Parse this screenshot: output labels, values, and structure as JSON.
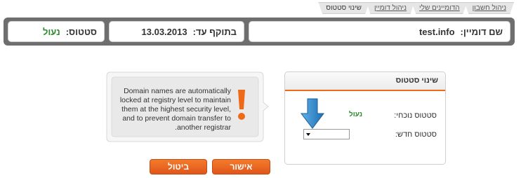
{
  "breadcrumbs": [
    "ניהול חשבון",
    "הדומיינים שלי",
    "ניהול דומיין",
    "שינוי סטטוס"
  ],
  "domain_bar": {
    "domain_label": "שם דומיין:",
    "domain_value": "test.info",
    "expiry_label": "בתוקף עד:",
    "expiry_value": "13.03.2013",
    "status_label": "סטטוס:",
    "status_value": "נעול"
  },
  "status_box": {
    "title": "שינוי סטטוס",
    "current_label": "סטטוס נוכחי:",
    "current_value": "נעול",
    "new_label": "סטטוס חדש:"
  },
  "info": {
    "text": "Domain names are automatically locked at registry level to maintain them at the highest security level, and to prevent domain transfer to .another registrar"
  },
  "buttons": {
    "confirm": "אישור",
    "cancel": "ביטול"
  },
  "colors": {
    "accent": "#ef6a18",
    "status_green": "#2e8b2e",
    "arrow_blue": "#2f86c9"
  }
}
